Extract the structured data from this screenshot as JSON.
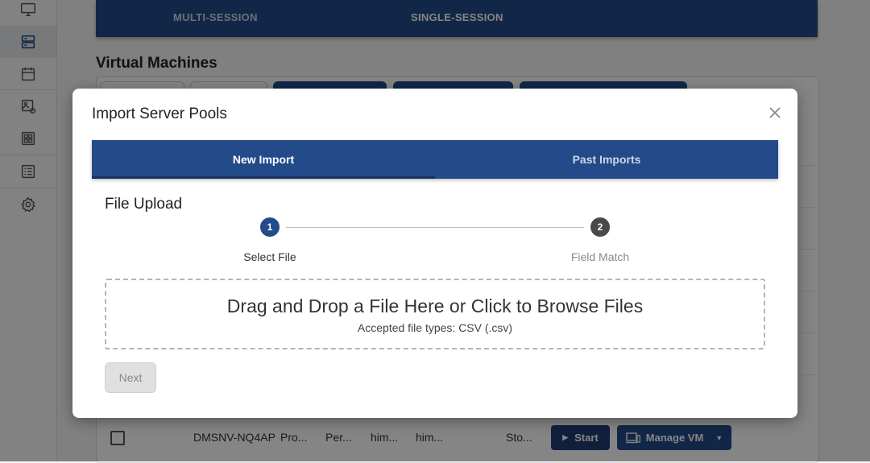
{
  "background": {
    "session_tabs": [
      {
        "label": "MULTI-SESSION",
        "active": false
      },
      {
        "label": "SINGLE-SESSION",
        "active": true
      }
    ],
    "section_title": "Virtual Machines",
    "row": {
      "name": "DMSNV-NQ4AP",
      "col2": "Pro...",
      "col3": "Per...",
      "col4": "him...",
      "col5": "him...",
      "col6": "Sto...",
      "start_label": "Start",
      "manage_label": "Manage VM"
    }
  },
  "sidebar": {
    "icons": [
      "monitor-icon",
      "server-icon",
      "calendar-icon",
      "image-link-icon",
      "grid-icon",
      "list-icon",
      "gear-icon"
    ]
  },
  "modal": {
    "title": "Import Server Pools",
    "tabs": [
      {
        "label": "New Import",
        "active": true
      },
      {
        "label": "Past Imports",
        "active": false
      }
    ],
    "section_title": "File Upload",
    "steps": [
      {
        "number": "1",
        "label": "Select File",
        "active": true
      },
      {
        "number": "2",
        "label": "Field Match",
        "active": false
      }
    ],
    "dropzone": {
      "main_text": "Drag and Drop a File Here or Click to Browse Files",
      "sub_text": "Accepted file types: CSV (.csv)"
    },
    "next_label": "Next"
  },
  "colors": {
    "primary": "#234b8a",
    "inactive_step": "#4a4a4a"
  }
}
